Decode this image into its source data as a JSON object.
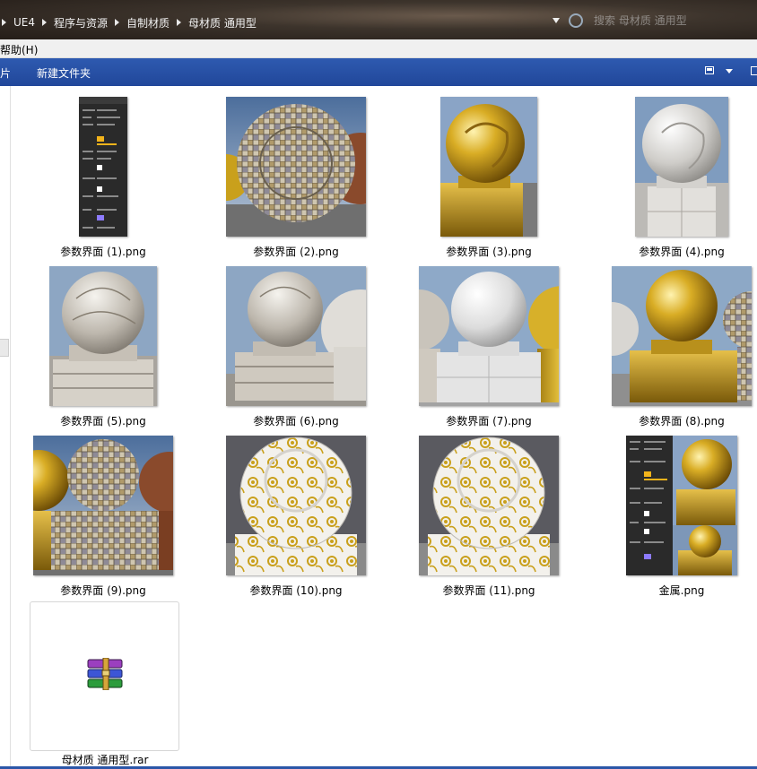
{
  "breadcrumb": {
    "items": [
      "UE4",
      "程序与资源",
      "自制材质",
      "母材质 通用型"
    ]
  },
  "search": {
    "placeholder": "搜索 母材质 通用型"
  },
  "menubar": {
    "help": "帮助(H)"
  },
  "toolbar": {
    "left_cut": "片",
    "new_folder": "新建文件夹"
  },
  "files": [
    {
      "name": "参数界面 (1).png",
      "kind": "ui-panel"
    },
    {
      "name": "参数界面 (2).png",
      "kind": "tile-sphere"
    },
    {
      "name": "参数界面 (3).png",
      "kind": "gold-sphere"
    },
    {
      "name": "参数界面 (4).png",
      "kind": "marble-sphere"
    },
    {
      "name": "参数界面 (5).png",
      "kind": "wood-marble-sphere"
    },
    {
      "name": "参数界面 (6).png",
      "kind": "wood-marble-sphere"
    },
    {
      "name": "参数界面 (7).png",
      "kind": "white-marble-sphere"
    },
    {
      "name": "参数界面 (8).png",
      "kind": "gold-sphere"
    },
    {
      "name": "参数界面 (9).png",
      "kind": "tile-sphere"
    },
    {
      "name": "参数界面 (10).png",
      "kind": "rose-pattern-sphere"
    },
    {
      "name": "参数界面 (11).png",
      "kind": "rose-pattern-sphere"
    },
    {
      "name": "金属.png",
      "kind": "ui-panel-gold"
    },
    {
      "name": "母材质 通用型.rar",
      "kind": "winrar-archive-icon"
    }
  ],
  "colors": {
    "toolbar": "#21479a",
    "gold": "#c9a01c",
    "marble": "#d7d4cf",
    "sky": "#6f8fb4"
  }
}
